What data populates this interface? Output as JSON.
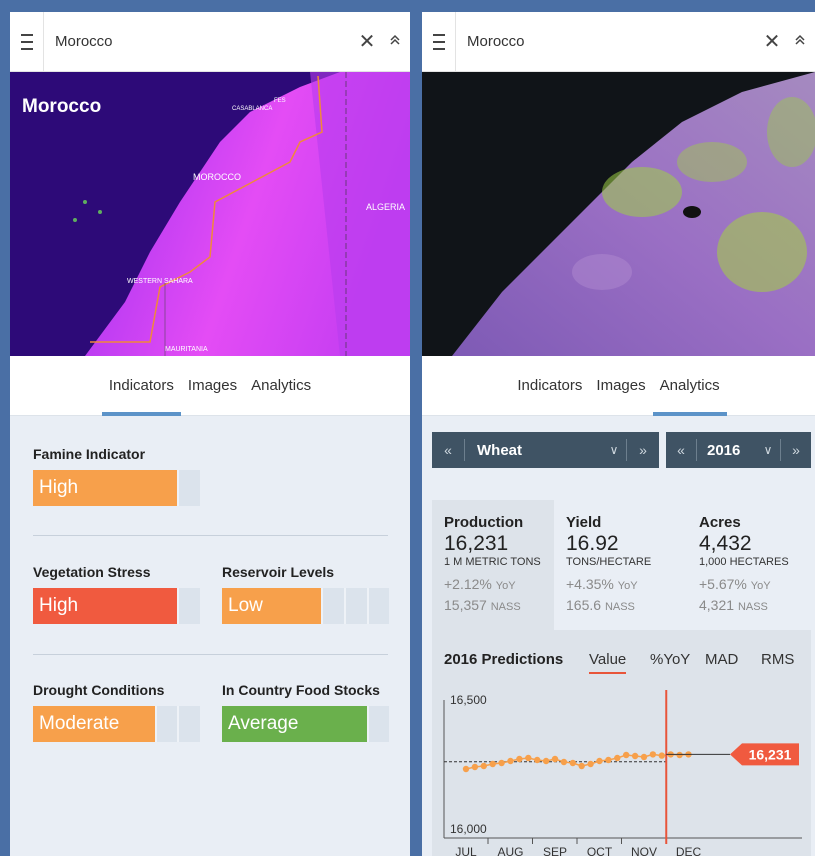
{
  "left_panel": {
    "search": {
      "value": "Morocco",
      "close": "✕",
      "collapse": "≫"
    },
    "map": {
      "country_label": "Morocco",
      "places": [
        "FES",
        "CASABLANCA",
        "MOROCCO",
        "ALGERIA",
        "WESTERN SAHARA",
        "MAURITANIA"
      ]
    },
    "tabs": [
      "Indicators",
      "Images",
      "Analytics"
    ],
    "active_tab": "Indicators",
    "indicators": {
      "famine": {
        "label": "Famine Indicator",
        "value": "High",
        "level": 0.85,
        "color": "#f7a04b"
      },
      "vegetation": {
        "label": "Vegetation Stress",
        "value": "High",
        "level": 0.85,
        "color": "#f05a3f"
      },
      "reservoir": {
        "label": "Reservoir Levels",
        "value": "Low",
        "level": 0.59,
        "color": "#f7a04b"
      },
      "drought": {
        "label": "Drought Conditions",
        "value": "Moderate",
        "level": 0.72,
        "color": "#f7a04b"
      },
      "food_stocks": {
        "label": "In Country Food Stocks",
        "value": "Average",
        "level": 0.86,
        "color": "#6ab04c"
      }
    }
  },
  "right_panel": {
    "search": {
      "value": "Morocco",
      "close": "✕",
      "collapse": "≫"
    },
    "tabs": [
      "Indicators",
      "Images",
      "Analytics"
    ],
    "active_tab": "Analytics",
    "crop_selector": {
      "prev": "«",
      "value": "Wheat",
      "dropdown": "∨",
      "next": "»"
    },
    "year_selector": {
      "prev": "«",
      "value": "2016",
      "dropdown": "∨",
      "next": "»"
    },
    "stats": [
      {
        "title": "Production",
        "value": "16,231",
        "unit": "1 M METRIC TONS",
        "yoy": "+2.12%",
        "yoy_suffix": "YoY",
        "nass": "15,357",
        "nass_suffix": "NASS"
      },
      {
        "title": "Yield",
        "value": "16.92",
        "unit": "TONS/HECTARE",
        "yoy": "+4.35%",
        "yoy_suffix": "YoY",
        "nass": "165.6",
        "nass_suffix": "NASS"
      },
      {
        "title": "Acres",
        "value": "4,432",
        "unit": "1,000 HECTARES",
        "yoy": "+5.67%",
        "yoy_suffix": "YoY",
        "nass": "4,321",
        "nass_suffix": "NASS"
      }
    ],
    "predictions": {
      "title": "2016 Predictions",
      "tabs": [
        "Value",
        "%YoY",
        "MAD",
        "RMS"
      ],
      "active_tab": "Value"
    }
  },
  "chart_data": {
    "type": "line",
    "title": "",
    "x_ticks": [
      "JUL",
      "AUG",
      "SEP",
      "OCT",
      "NOV",
      "DEC"
    ],
    "ylim": [
      16000,
      16500
    ],
    "y_ticks": [
      "16,500",
      "16,000"
    ],
    "series": [
      {
        "x": [
          0,
          0.2,
          0.4,
          0.6,
          0.8,
          1.0,
          1.2,
          1.4,
          1.6,
          1.8,
          2.0,
          2.2,
          2.4,
          2.6,
          2.8,
          3.0,
          3.2,
          3.4,
          3.6,
          3.8,
          4.0,
          4.2,
          4.4,
          4.6,
          4.8,
          5.0
        ],
        "values": [
          16195,
          16205,
          16210,
          16220,
          16225,
          16235,
          16245,
          16250,
          16240,
          16235,
          16245,
          16230,
          16225,
          16210,
          16220,
          16235,
          16240,
          16250,
          16265,
          16260,
          16255,
          16268,
          16262,
          16268,
          16265,
          16268
        ]
      }
    ],
    "reference_line": 16231,
    "current_marker_x": 4.5,
    "callout_value": "16,231",
    "colors": {
      "points": "#f7a04b",
      "marker": "#e8553a",
      "callout": "#f05a3f"
    }
  }
}
